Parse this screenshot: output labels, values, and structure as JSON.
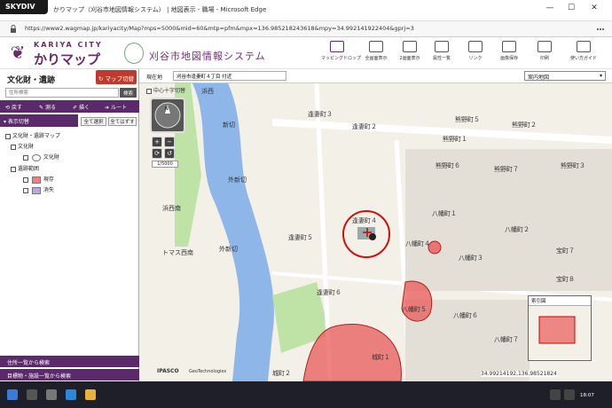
{
  "window": {
    "badge": "SKYDIV",
    "title": "かりマップ（刈谷市地図情報システム） | 地図表示 - 職場 - Microsoft Edge",
    "minimize": "—",
    "maximize": "☐",
    "close": "✕"
  },
  "addressbar": {
    "url": "https://www2.wagmap.jp/kariyacity/Map?mps=5000&mid=60&mtp=pfm&mpx=136.985218243618&mpy=34.992141922404&gprj=3"
  },
  "header": {
    "logo_sub": "KARIYA CITY",
    "logo_main": "かりマップ",
    "system_title": "刈谷市地図情報システム",
    "tools": [
      {
        "label": "マッピングドロップ",
        "icon": "mapping-drop-icon"
      },
      {
        "label": "全画面表示",
        "icon": "fullscreen-icon"
      },
      {
        "label": "2画面表示",
        "icon": "split-screen-icon"
      },
      {
        "label": "属性一覧",
        "icon": "attribute-list-icon"
      },
      {
        "label": "リンク",
        "icon": "link-icon"
      },
      {
        "label": "画像保存",
        "icon": "save-image-icon"
      },
      {
        "label": "印刷",
        "icon": "print-icon"
      },
      {
        "label": "使い方ガイド",
        "icon": "guide-icon"
      }
    ],
    "tool_logo_text": "Mapped Drop"
  },
  "leftpanel": {
    "title": "文化財・遺跡",
    "map_switch": "マップ切替",
    "search_placeholder": "住所検索",
    "search_button": "検索",
    "actions": [
      "戻す",
      "測る",
      "描く",
      "ルート"
    ],
    "layer_tab": "表示切替",
    "select_all": "全て選択",
    "deselect_all": "全てはずす",
    "tree": {
      "root": "文化財・遺跡マップ",
      "cultural": "文化財",
      "cultural_child": "文化財",
      "ruins": "遺跡範囲",
      "ruins_current": "現存",
      "ruins_lost": "消失"
    },
    "bottom_1": "住所一覧から検索",
    "bottom_2": "目標物・施設一覧から検索"
  },
  "map": {
    "loc_label": "現在地",
    "loc_value": "刈谷市逢妻町４丁目 付近",
    "basemap": "案内地図",
    "checkbox_label": "中心十字切替",
    "scale": "1/5000",
    "labels": {
      "l1": "逢妻町３",
      "l2": "逢妻町２",
      "l3": "熊野町５",
      "l4": "熊野町６",
      "l5": "熊野町７",
      "l6": "熊野町３",
      "l7": "逢妻町４",
      "l8": "八幡町１",
      "l9": "八幡町４",
      "l10": "八幡町３",
      "l11": "八幡町２",
      "l12": "逢妻町５",
      "l13": "逢妻町６",
      "l14": "八幡町５",
      "l15": "八幡町６",
      "l16": "宝町７",
      "l17": "宝町８",
      "l18": "外新切",
      "l19": "浜西南",
      "l20": "トマス西南",
      "l21": "城町１",
      "l22": "浜西",
      "l23": "新切",
      "l24": "熊野町１",
      "l25": "熊野町２",
      "l26": "城町２",
      "l27": "八幡町７",
      "l28": "外新切"
    },
    "copyright_1": "IPASCO",
    "copyright_2": "GeoTechnologies",
    "overview_title": "索引図",
    "coord": "34.99214192,136.98521824"
  },
  "taskbar": {
    "time": "18:07",
    "date": "",
    "lang": "A"
  },
  "colors": {
    "brand": "#6a2a6a",
    "accent_red": "#c0392b",
    "site_fill": "#e85a5a",
    "river": "#8fb6e8",
    "park": "#bfe3a6"
  }
}
